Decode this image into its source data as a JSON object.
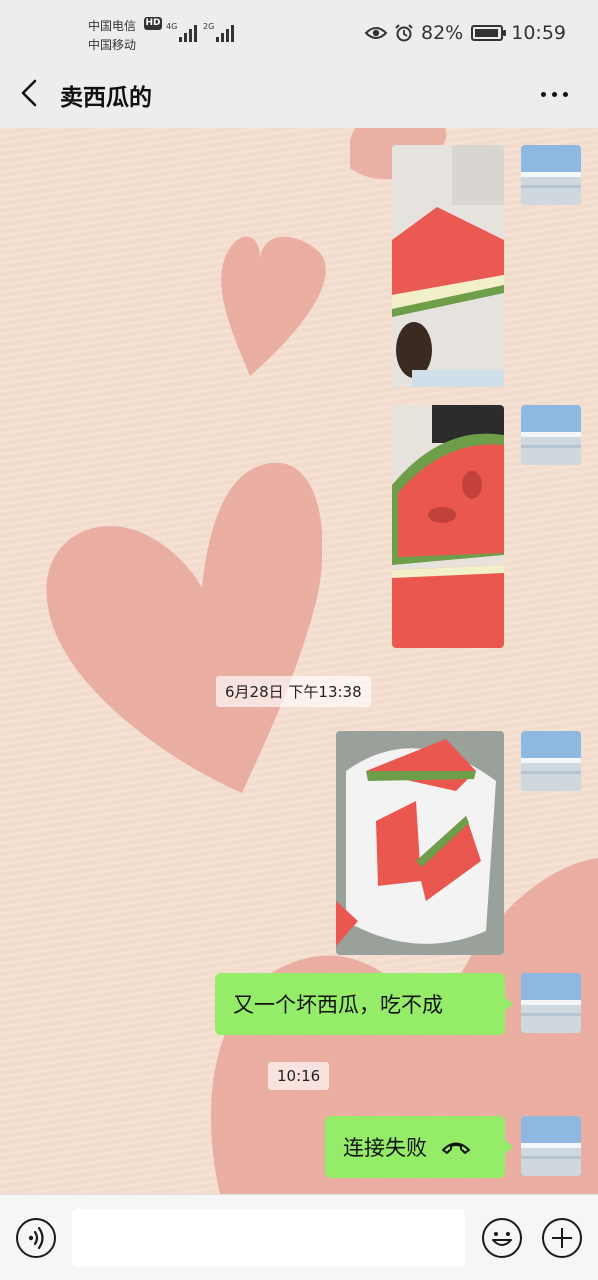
{
  "status_bar": {
    "carrier_1": "中国电信",
    "carrier_1_badge": "HD",
    "carrier_2": "中国移动",
    "signal_1": "4G",
    "signal_2": "2G",
    "battery": "82%",
    "time": "10:59",
    "icons": [
      "eye-icon",
      "alarm-icon",
      "battery-icon"
    ]
  },
  "nav": {
    "title": "卖西瓜的",
    "back_icon": "chevron-left-icon",
    "more_icon": "more-dots-icon"
  },
  "chat": {
    "time_badge_1": "6月28日 下午13:38",
    "message_text": "又一个坏西瓜，吃不成",
    "time_badge_2": "10:16",
    "call_text": "连接失败",
    "call_icon": "hangup-phone-icon",
    "bubble_color": "#95ec69"
  },
  "input": {
    "value": "",
    "icons": [
      "voice-icon",
      "emoji-icon",
      "plus-icon"
    ]
  },
  "colors": {
    "background": "#f4ded0",
    "heart": "#e8a59a",
    "bar": "#ededed"
  }
}
